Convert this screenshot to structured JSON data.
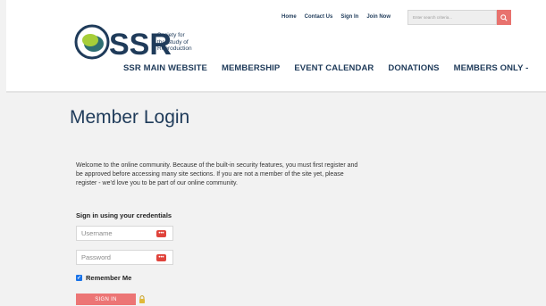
{
  "header": {
    "top_links": [
      "Home",
      "Contact Us",
      "Sign In",
      "Join Now"
    ],
    "search_placeholder": "Enter search criteria...",
    "logo_abbr": "SSR",
    "logo_lines": [
      "Society for",
      "the Study of",
      "Reproduction"
    ],
    "nav": [
      "SSR MAIN WEBSITE",
      "MEMBERSHIP",
      "EVENT CALENDAR",
      "DONATIONS",
      "MEMBERS ONLY -"
    ]
  },
  "main": {
    "title": "Member Login",
    "welcome": "Welcome to the online community. Because of the built-in security features, you must first register and be approved before accessing many site sections. If you are not a member of the site yet, please register - we'd love you to be part of our online community.",
    "creds_title": "Sign in using your credentials",
    "username_placeholder": "Username",
    "password_placeholder": "Password",
    "remember_label": "Remember Me",
    "signin_label": "SIGN IN"
  },
  "colors": {
    "navy": "#1f3b5a",
    "accent": "#e8726e",
    "logo_green": "#a6ce39",
    "logo_teal": "#2f6f73"
  }
}
